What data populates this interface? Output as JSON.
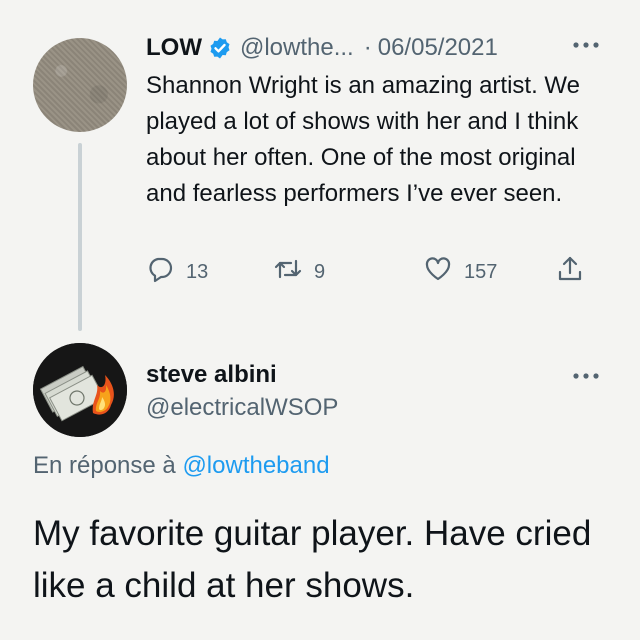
{
  "tweet": {
    "author_name": "LOW",
    "handle": "@lowthe...",
    "separator": "·",
    "date": "06/05/2021",
    "text": "Shannon Wright is an amazing artist. We played a lot of shows with her and I think about her often. One of the most original and fearless performers I’ve ever seen.",
    "replies": "13",
    "retweets": "9",
    "likes": "157",
    "verified": true
  },
  "reply": {
    "author_name": "steve albini",
    "handle": "@electricalWSOP",
    "replying_label": "En réponse à ",
    "replying_to": "@lowtheband",
    "text": "My favorite guitar player. Have cried like a child at her shows."
  },
  "icons": {
    "verified": "verified-badge-icon",
    "more": "more-horizontal-icon",
    "reply": "reply-icon",
    "retweet": "retweet-icon",
    "like": "heart-icon",
    "share": "share-icon"
  },
  "colors": {
    "link": "#1d9bf0",
    "secondary_text": "#536471",
    "primary_text": "#0f1419",
    "thread_line": "#c9d1d5"
  }
}
